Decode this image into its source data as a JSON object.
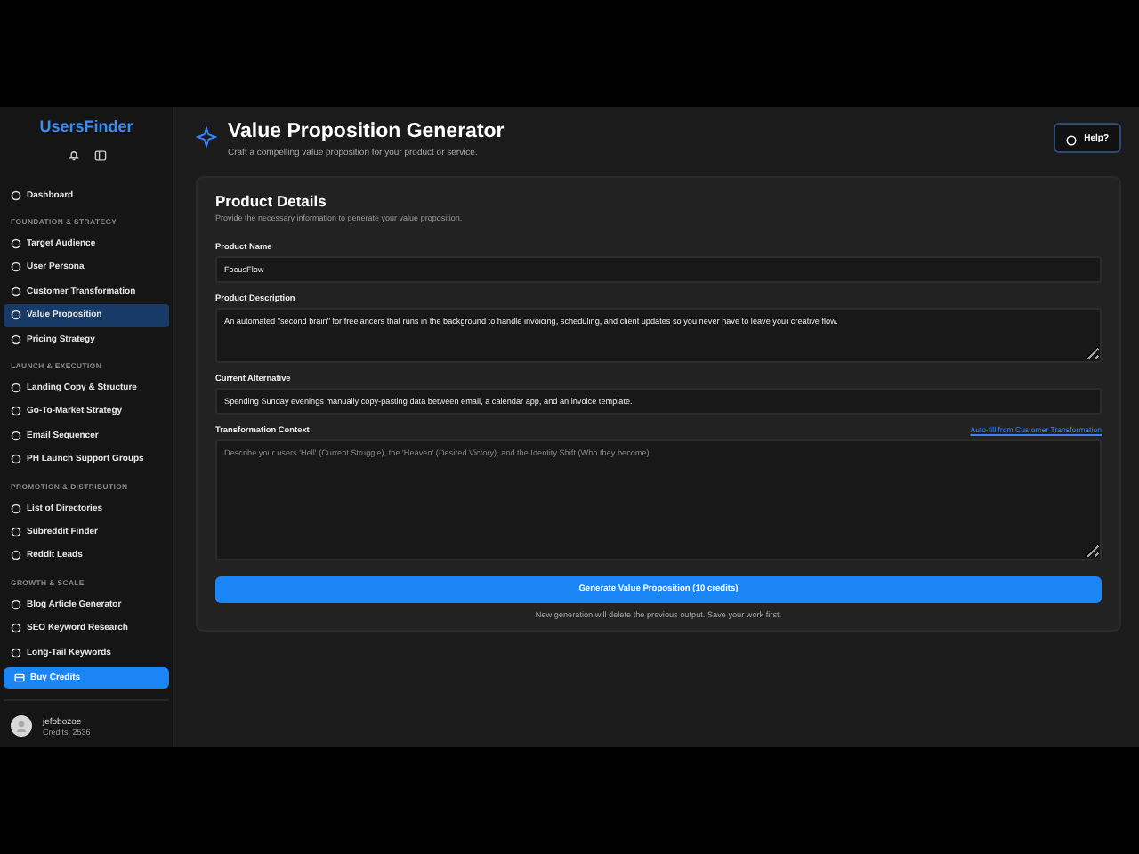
{
  "sidebar": {
    "brand": "UsersFinder",
    "sections": [
      {
        "items": [
          {
            "label": "Dashboard",
            "selected": false
          }
        ]
      },
      {
        "heading": "FOUNDATION & STRATEGY",
        "items": [
          {
            "label": "Target Audience",
            "selected": false
          },
          {
            "label": "User Persona",
            "selected": false
          },
          {
            "label": "Customer Transformation",
            "selected": false
          },
          {
            "label": "Value Proposition",
            "selected": true
          },
          {
            "label": "Pricing Strategy",
            "selected": false
          }
        ]
      },
      {
        "heading": "LAUNCH & EXECUTION",
        "items": [
          {
            "label": "Landing Copy & Structure",
            "selected": false
          },
          {
            "label": "Go-To-Market Strategy",
            "selected": false
          },
          {
            "label": "Email Sequencer",
            "selected": false
          },
          {
            "label": "PH Launch Support Groups",
            "selected": false
          }
        ]
      },
      {
        "heading": "PROMOTION & DISTRIBUTION",
        "items": [
          {
            "label": "List of Directories",
            "selected": false
          },
          {
            "label": "Subreddit Finder",
            "selected": false
          },
          {
            "label": "Reddit Leads",
            "selected": false
          }
        ]
      },
      {
        "heading": "GROWTH & SCALE",
        "items": [
          {
            "label": "Blog Article Generator",
            "selected": false
          },
          {
            "label": "SEO Keyword Research",
            "selected": false
          },
          {
            "label": "Long-Tail Keywords",
            "selected": false
          }
        ]
      }
    ],
    "buy_button": "Buy Credits",
    "user": {
      "name": "jefobozoe",
      "credits": "Credits: 2536"
    }
  },
  "header": {
    "title": "Value Proposition Generator",
    "subtitle": "Craft a compelling value proposition for your product or service.",
    "help_button": "Help?"
  },
  "card": {
    "title": "Product Details",
    "subtitle": "Provide the necessary information to generate your value proposition.",
    "fields": [
      {
        "kind": "input",
        "label": "Product Name",
        "value": "FocusFlow"
      },
      {
        "kind": "textarea",
        "label": "Product Description",
        "value": "An automated \"second brain\" for freelancers that runs in the background to handle invoicing, scheduling, and client updates so you never have to leave your creative flow."
      },
      {
        "kind": "input",
        "label": "Current Alternative",
        "value": "Spending Sunday evenings manually copy-pasting data between email, a calendar app, and an invoice template."
      },
      {
        "kind": "textarea",
        "label": "Transformation Context",
        "placeholder": "Describe your users 'Hell' (Current Struggle), the 'Heaven' (Desired Victory), and the Identity Shift (Who they become).",
        "link": "Auto-fill from Customer Transformation"
      }
    ],
    "generate_button": "Generate Value Proposition (10 credits)",
    "note": "New generation will delete the previous output. Save your work first."
  }
}
